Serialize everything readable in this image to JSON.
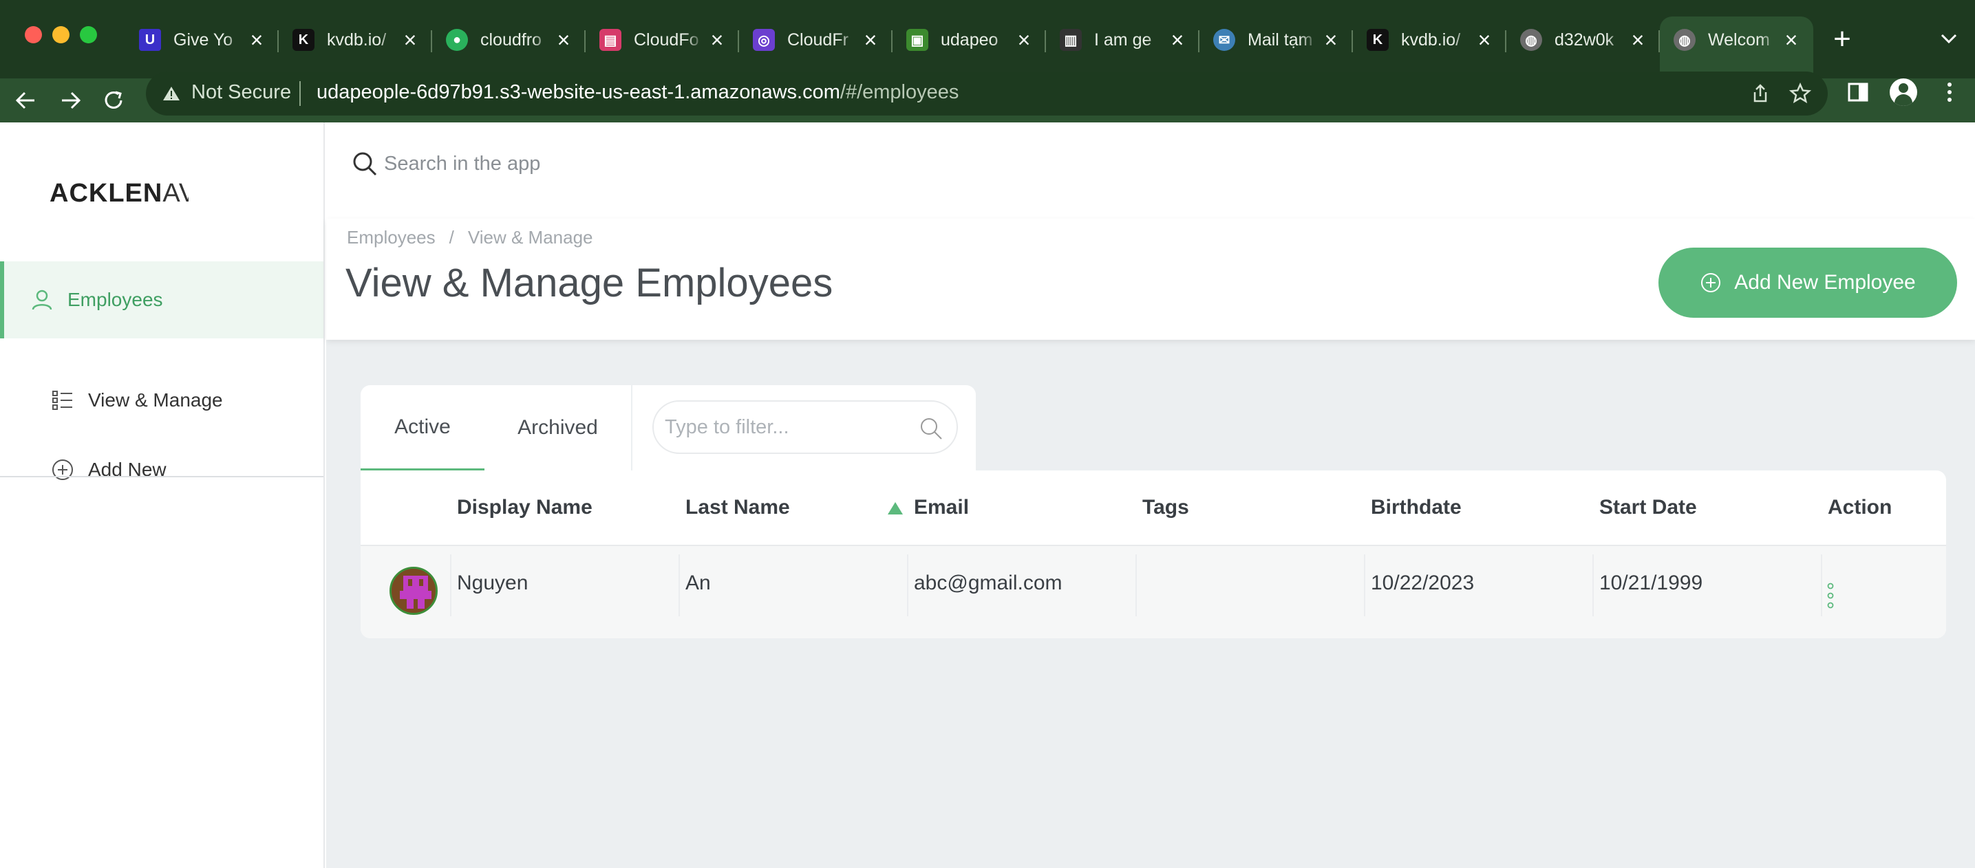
{
  "browser": {
    "tabs": [
      {
        "title": "Give Yo",
        "favicon": "udemy-icon",
        "color": "#3b30c9"
      },
      {
        "title": "kvdb.io/",
        "favicon": "kvdb-icon",
        "color": "#1a1a1a"
      },
      {
        "title": "cloudfro",
        "favicon": "circleci-icon",
        "color": "#2ab15c"
      },
      {
        "title": "CloudFo",
        "favicon": "cloudformation-icon",
        "color": "#d63b6a"
      },
      {
        "title": "CloudFr",
        "favicon": "cloudfront-icon",
        "color": "#6b3fcf"
      },
      {
        "title": "udapeo",
        "favicon": "s3-icon",
        "color": "#3c8a2e"
      },
      {
        "title": "I am ge",
        "favicon": "video-icon",
        "color": "#333333"
      },
      {
        "title": "Mail tạm",
        "favicon": "mail-icon",
        "color": "#3d7fb5"
      },
      {
        "title": "kvdb.io/",
        "favicon": "kvdb-icon",
        "color": "#1a1a1a"
      },
      {
        "title": "d32w0k",
        "favicon": "globe-icon",
        "color": "#6c6c6c"
      },
      {
        "title": "Welcom",
        "favicon": "globe-icon",
        "color": "#6c6c6c",
        "active": true
      }
    ],
    "not_secure_label": "Not Secure",
    "url_host": "udapeople-6d97b91.s3-website-us-east-1.amazonaws.com",
    "url_path": "/#/employees"
  },
  "app": {
    "logo_bold": "ACKLEN",
    "logo_thin": "AV",
    "search_placeholder": "Search in the app",
    "sidebar": {
      "section": "Employees",
      "items": [
        {
          "label": "View & Manage",
          "icon": "list-icon"
        },
        {
          "label": "Add New",
          "icon": "plus-circle-icon"
        }
      ]
    },
    "breadcrumb": [
      "Employees",
      "View & Manage"
    ],
    "page_title": "View & Manage Employees",
    "add_button_label": "Add New Employee",
    "tabs": [
      "Active",
      "Archived"
    ],
    "active_tab": "Active",
    "filter_placeholder": "Type to filter...",
    "accent_color": "#5cb97d",
    "table": {
      "columns": [
        "Display Name",
        "Last Name",
        "Email",
        "Tags",
        "Birthdate",
        "Start Date",
        "Action"
      ],
      "sorted_column": "Email",
      "rows": [
        {
          "display_name": "Nguyen",
          "last_name": "An",
          "email": "abc@gmail.com",
          "tags": "",
          "birthdate": "10/22/2023",
          "start_date": "10/21/1999"
        }
      ]
    }
  }
}
